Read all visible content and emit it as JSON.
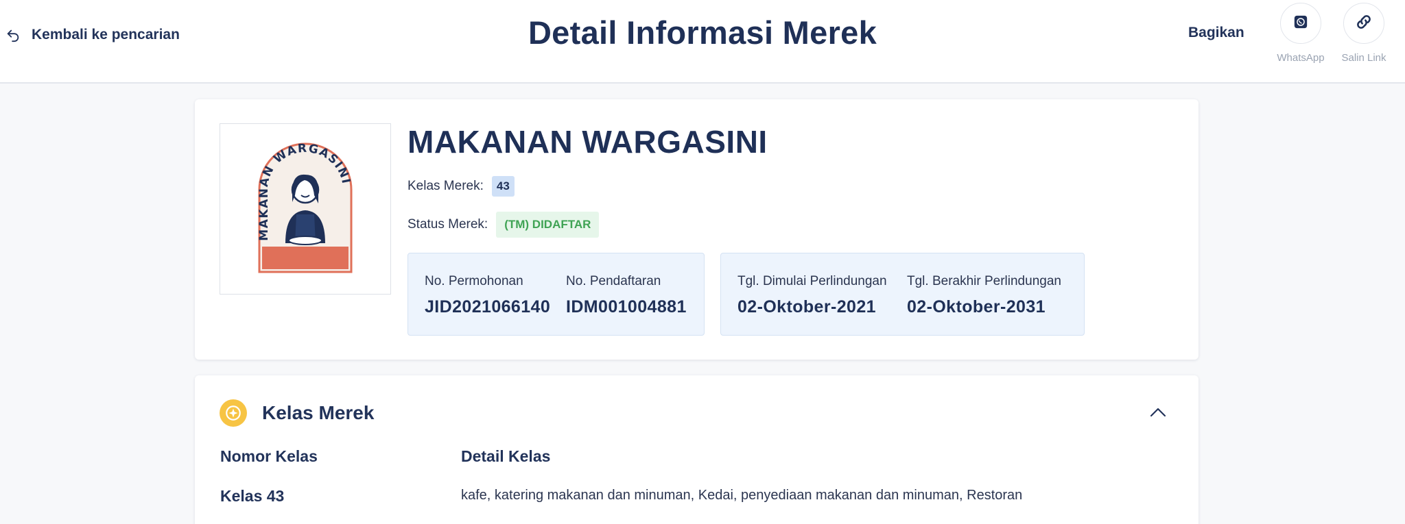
{
  "header": {
    "back_label": "Kembali ke pencarian",
    "title": "Detail Informasi Merek",
    "share_label": "Bagikan",
    "share_options": [
      {
        "label": "WhatsApp",
        "icon": "whatsapp-icon"
      },
      {
        "label": "Salin Link",
        "icon": "link-icon"
      }
    ]
  },
  "brand": {
    "name": "MAKANAN WARGASINI",
    "logo_text": "MAKANAN WARGASINI",
    "class_label": "Kelas Merek:",
    "class_value": "43",
    "status_label": "Status Merek:",
    "status_value": "(TM) DIDAFTAR"
  },
  "registration": {
    "application_no_label": "No. Permohonan",
    "application_no": "JID2021066140",
    "registration_no_label": "No. Pendaftaran",
    "registration_no": "IDM001004881",
    "protection_start_label": "Tgl. Dimulai Perlindungan",
    "protection_start": "02-Oktober-2021",
    "protection_end_label": "Tgl. Berakhir Perlindungan",
    "protection_end": "02-Oktober-2031"
  },
  "class_section": {
    "title": "Kelas Merek",
    "columns": [
      "Nomor Kelas",
      "Detail Kelas"
    ],
    "rows": [
      {
        "number": "Kelas 43",
        "detail": "kafe, katering makanan dan minuman, Kedai, penyediaan makanan dan minuman, Restoran"
      }
    ]
  },
  "colors": {
    "primary_text": "#1f3057",
    "status_green": "#3fa354",
    "status_bg": "#e6f6ea",
    "class_badge_bg": "#cfe0f7",
    "info_bg": "#edf4fd",
    "accent_yellow": "#f7c444",
    "logo_orange": "#e07059"
  }
}
